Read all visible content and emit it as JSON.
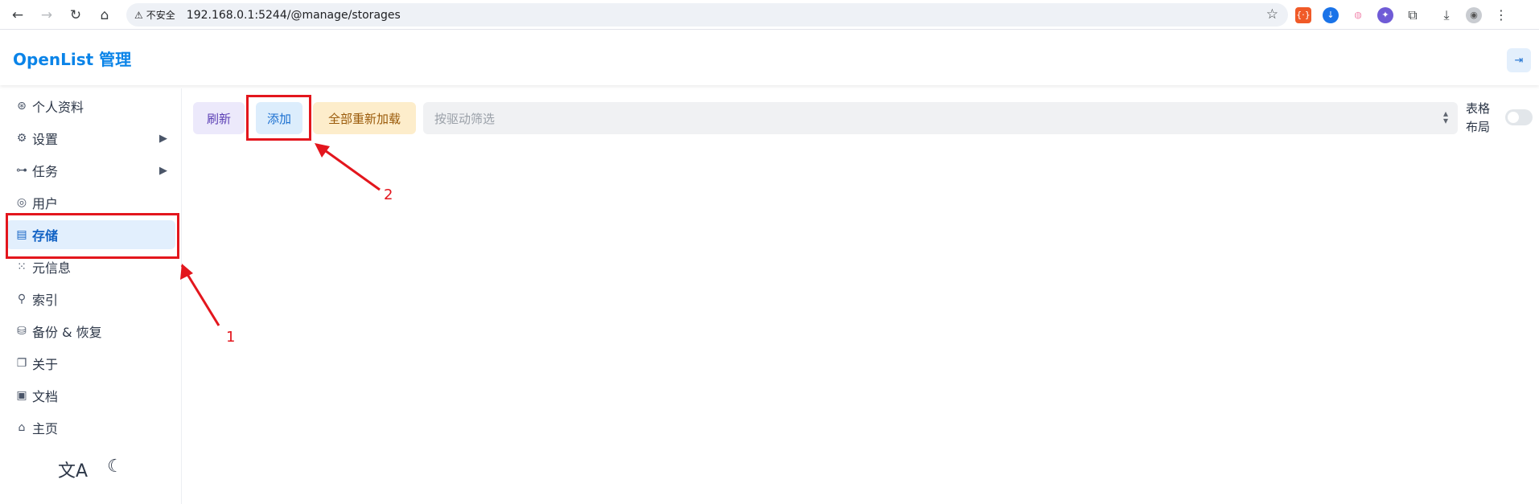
{
  "browser": {
    "url": "192.168.0.1:5244/@manage/storages",
    "security_label": "不安全",
    "nav_icons": [
      "back-arrow-icon",
      "forward-arrow-icon",
      "reload-icon",
      "home-icon"
    ],
    "extensions": [
      "extension-red-icon",
      "extension-download-icon",
      "extension-pink-icon",
      "extension-purple-icon",
      "puzzle-icon",
      "download-icon",
      "profile-avatar-icon",
      "more-vert-icon"
    ]
  },
  "app": {
    "title": "OpenList 管理"
  },
  "sidebar": {
    "items": [
      {
        "label": "个人资料",
        "icon": "fingerprint-icon",
        "arrow": ""
      },
      {
        "label": "设置",
        "icon": "gear-icon",
        "arrow": "▶"
      },
      {
        "label": "任务",
        "icon": "flow-icon",
        "arrow": "▶"
      },
      {
        "label": "用户",
        "icon": "user-icon",
        "arrow": ""
      },
      {
        "label": "存储",
        "icon": "storage-icon",
        "arrow": "",
        "active": true
      },
      {
        "label": "元信息",
        "icon": "meta-icon",
        "arrow": ""
      },
      {
        "label": "索引",
        "icon": "search-icon",
        "arrow": ""
      },
      {
        "label": "备份 & 恢复",
        "icon": "database-icon",
        "arrow": ""
      },
      {
        "label": "关于",
        "icon": "copy-icon",
        "arrow": ""
      },
      {
        "label": "文档",
        "icon": "book-icon",
        "arrow": ""
      },
      {
        "label": "主页",
        "icon": "home-icon",
        "arrow": ""
      }
    ],
    "bottom": [
      "translate-icon",
      "moon-icon"
    ]
  },
  "toolbar": {
    "refresh_label": "刷新",
    "add_label": "添加",
    "reload_all_label": "全部重新加载",
    "filter_placeholder": "按驱动筛选",
    "layout_label_line1": "表格",
    "layout_label_line2": "布局",
    "table_layout_on": false
  },
  "annotations": {
    "label_1": "1",
    "label_2": "2",
    "color": "#e3161d"
  },
  "colors": {
    "accent": "#0b84e8",
    "active_bg": "#e2effd",
    "refresh_bg": "#ece9fb",
    "add_bg": "#dcedfc",
    "reload_bg": "#fdedcb"
  }
}
